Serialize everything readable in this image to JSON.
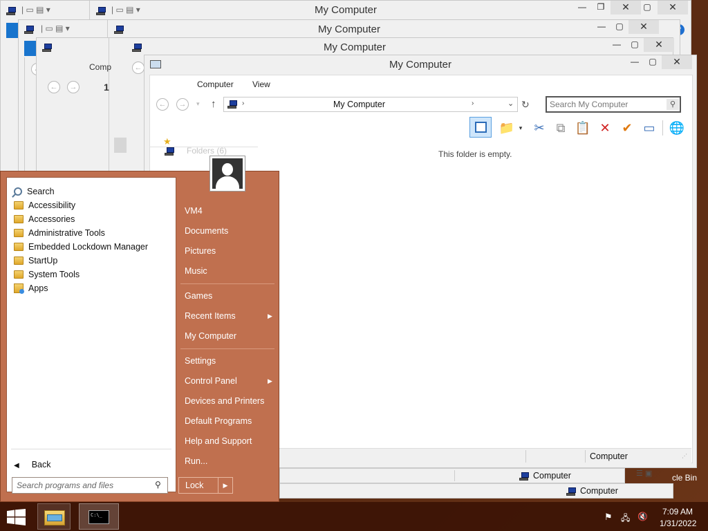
{
  "windows": {
    "title": "My Computer",
    "back_titles": [
      "My Computer",
      "My Computer",
      "My Computer"
    ],
    "partial_crumb": "Comp",
    "partial_num": "1"
  },
  "explorer": {
    "title": "My Computer",
    "menu": [
      "Computer",
      "View"
    ],
    "address": "My Computer",
    "search_placeholder": "Search My Computer",
    "empty_text": "This folder is empty.",
    "group_header": "Folders (6)",
    "status_right": "Computer",
    "status_under_1": "Computer",
    "status_under_2": "Computer",
    "recycle_partial": "cle Bin"
  },
  "start_menu": {
    "programs": [
      {
        "label": "Search",
        "icon": "search-icon"
      },
      {
        "label": "Accessibility",
        "icon": "folder-icon"
      },
      {
        "label": "Accessories",
        "icon": "folder-icon"
      },
      {
        "label": "Administrative Tools",
        "icon": "folder-icon"
      },
      {
        "label": "Embedded Lockdown Manager",
        "icon": "folder-icon"
      },
      {
        "label": "StartUp",
        "icon": "folder-icon"
      },
      {
        "label": "System Tools",
        "icon": "folder-icon"
      },
      {
        "label": "Apps",
        "icon": "apps-icon"
      }
    ],
    "back_label": "Back",
    "search_placeholder": "Search programs and files",
    "right_items": [
      "VM4",
      "Documents",
      "Pictures",
      "Music",
      "Games",
      "Recent Items",
      "My Computer",
      "Settings",
      "Control Panel",
      "Devices and Printers",
      "Default Programs",
      "Help and Support",
      "Run..."
    ],
    "lock_label": "Lock"
  },
  "taskbar": {
    "time": "7:09 AM",
    "date": "1/31/2022"
  }
}
